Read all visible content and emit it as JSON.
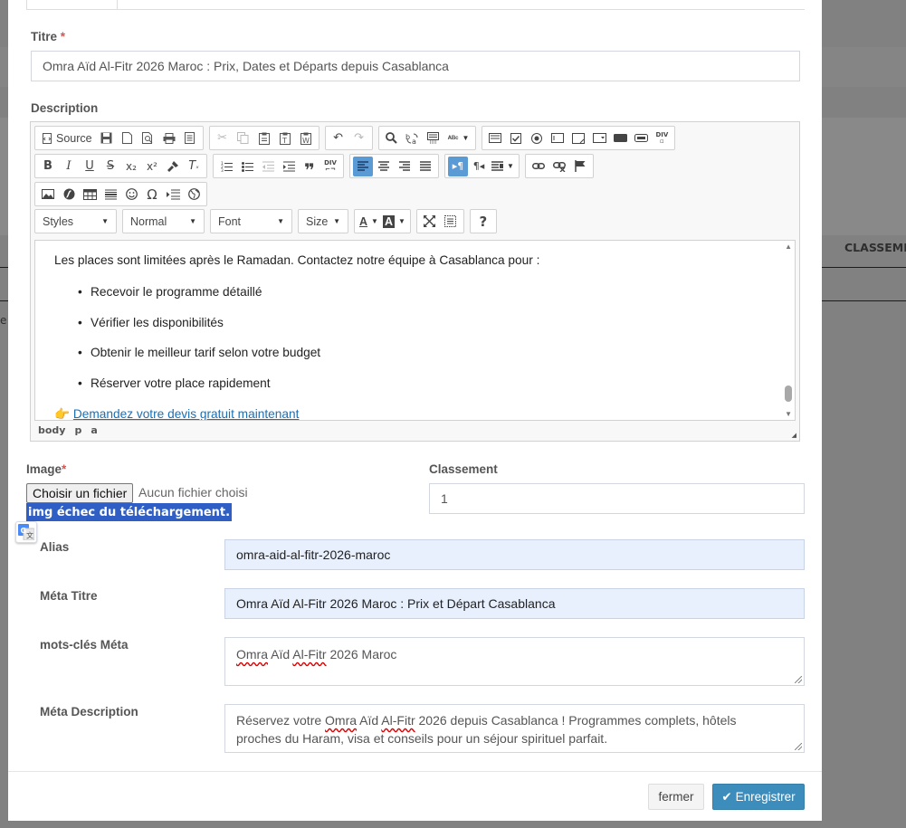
{
  "background": {
    "column_header": "CLASSEMENT",
    "row_fragment": "e"
  },
  "form": {
    "title_label": "Titre",
    "required_mark": "*",
    "title_value": "Omra Aïd Al-Fitr 2026 Maroc : Prix, Dates et Départs depuis Casablanca",
    "description_label": "Description",
    "image_label": "Image",
    "file_button": "Choisir un fichier",
    "file_status": "Aucun fichier choisi",
    "image_error": "img échec du téléchargement.",
    "rank_label": "Classement",
    "rank_value": "1",
    "alias_label": "Alias",
    "alias_value": "omra-aid-al-fitr-2026-maroc",
    "meta_title_label": "Méta Titre",
    "meta_title_value": "Omra Aïd Al-Fitr 2026 Maroc : Prix et Départ Casablanca",
    "meta_keywords_label": "mots-clés Méta",
    "meta_keywords_words": [
      "Omra",
      "Aïd",
      "Al-Fitr",
      "2026",
      "Maroc"
    ],
    "meta_desc_label": "Méta Description",
    "meta_desc_line1_parts": [
      "Réservez votre ",
      "Omra",
      " Aïd ",
      "Al-Fitr",
      " 2026 depuis Casablanca ! Programmes complets, hôtels"
    ],
    "meta_desc_line2": "proches du Haram, visa et conseils pour un séjour spirituel parfait."
  },
  "editor": {
    "source_label": "Source",
    "combos": {
      "styles": "Styles",
      "format": "Normal",
      "font": "Font",
      "size": "Size"
    },
    "content": {
      "intro": "Les places sont limitées après le Ramadan. Contactez notre équipe à Casablanca pour :",
      "items": [
        "Recevoir le programme détaillé",
        "Vérifier les disponibilités",
        "Obtenir le meilleur tarif selon votre budget",
        "Réserver votre place rapidement"
      ],
      "cta_emoji": "👉",
      "cta_link": "Demandez votre devis gratuit maintenant"
    },
    "path": [
      "body",
      "p",
      "a"
    ]
  },
  "footer": {
    "close_label": "fermer",
    "save_label": "Enregistrer"
  },
  "colors": {
    "accent": "#3c8dbc",
    "required": "#d9534f",
    "error_highlight": "#2f5fc4",
    "autofill": "#e8f0fe"
  }
}
